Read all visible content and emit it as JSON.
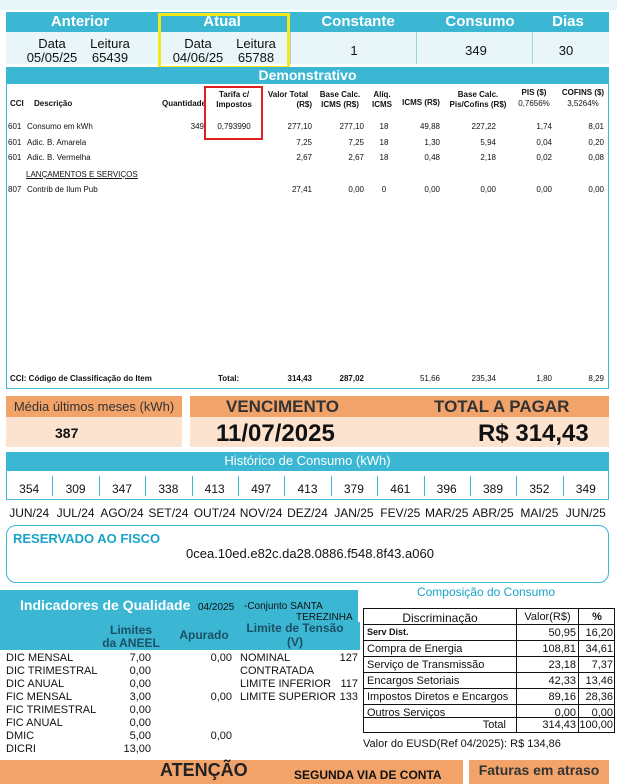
{
  "readings": {
    "headers": [
      "Anterior",
      "Atual",
      "Constante",
      "Consumo",
      "Dias"
    ],
    "sub_data": "Data",
    "sub_leitura": "Leitura",
    "anterior_data": "05/05/25",
    "anterior_leitura": "65439",
    "atual_data": "04/06/25",
    "atual_leitura": "65788",
    "constante": "1",
    "consumo": "349",
    "dias": "30"
  },
  "demo": {
    "title": "Demonstrativo",
    "cols": {
      "cci": "CCI",
      "desc": "Descrição",
      "qtd": "Quantidade",
      "tarifa1": "Tarifa c/",
      "tarifa2": "Impostos",
      "vt1": "Valor Total",
      "vt2": "(R$)",
      "bc1": "Base Calc.",
      "bc2": "ICMS (R$)",
      "aliq1": "Alíq.",
      "aliq2": "ICMS",
      "icms": "ICMS (R$)",
      "bcp1": "Base Calc.",
      "bcp2": "Pis/Cofins (R$)",
      "pis1": "PIS ($)",
      "pis2": "0,7656%",
      "cof1": "COFINS ($)",
      "cof2": "3,5264%"
    },
    "rows": [
      {
        "cci": "601",
        "desc": "Consumo em kWh",
        "qtd": "349",
        "tarifa": "0,793990",
        "vt": "277,10",
        "bc": "277,10",
        "aliq": "18",
        "icms": "49,88",
        "bcp": "227,22",
        "pis": "1,74",
        "cof": "8,01"
      },
      {
        "cci": "601",
        "desc": "Adic. B. Amarela",
        "qtd": "",
        "tarifa": "",
        "vt": "7,25",
        "bc": "7,25",
        "aliq": "18",
        "icms": "1,30",
        "bcp": "5,94",
        "pis": "0,04",
        "cof": "0,20"
      },
      {
        "cci": "601",
        "desc": "Adic. B. Vermelha",
        "qtd": "",
        "tarifa": "",
        "vt": "2,67",
        "bc": "2,67",
        "aliq": "18",
        "icms": "0,48",
        "bcp": "2,18",
        "pis": "0,02",
        "cof": "0,08"
      }
    ],
    "lanc": "LANÇAMENTOS E SERVIÇOS",
    "row4": {
      "cci": "807",
      "desc": "Contrib de Ilum Pub",
      "vt": "27,41",
      "bc": "0,00",
      "aliq": "0",
      "icms": "0,00",
      "bcp": "0,00",
      "pis": "0,00",
      "cof": "0,00"
    },
    "footer": {
      "label": "CCI: Código de Classificação do Item",
      "total": "Total:",
      "vt": "314,43",
      "bc": "287,02",
      "icms": "51,66",
      "bcp": "235,34",
      "pis": "1,80",
      "cof": "8,29"
    }
  },
  "media": {
    "label": "Média últimos meses (kWh)",
    "value": "387"
  },
  "vencimento": {
    "label": "VENCIMENTO",
    "value": "11/07/2025"
  },
  "total": {
    "label": "TOTAL A PAGAR",
    "value": "R$ 314,43"
  },
  "historico": {
    "title": "Histórico de Consumo (kWh)",
    "values": [
      "354",
      "309",
      "347",
      "338",
      "413",
      "497",
      "413",
      "379",
      "461",
      "396",
      "389",
      "352",
      "349"
    ],
    "months": [
      "JUN/24",
      "JUL/24",
      "AGO/24",
      "SET/24",
      "OUT/24",
      "NOV/24",
      "DEZ/24",
      "JAN/25",
      "FEV/25",
      "MAR/25",
      "ABR/25",
      "MAI/25",
      "JUN/25"
    ]
  },
  "fisco": {
    "label": "RESERVADO AO FISCO",
    "code": "0cea.10ed.e82c.da28.0886.f548.8f43.a060"
  },
  "indicadores": {
    "title": "Indicadores de Qualidade",
    "ref": "04/2025",
    "conj1": "-Conjunto SANTA",
    "conj2": "TEREZINHA",
    "col_limites1": "Limites",
    "col_limites2": "da ANEEL",
    "col_apurado": "Apurado",
    "col_tensao1": "Limite de Tensão",
    "col_tensao2": "(V)",
    "rows": [
      {
        "n": "DIC MENSAL",
        "l": "7,00",
        "a": "0,00"
      },
      {
        "n": "DIC TRIMESTRAL",
        "l": "0,00",
        "a": ""
      },
      {
        "n": "DIC ANUAL",
        "l": "0,00",
        "a": ""
      },
      {
        "n": "FIC MENSAL",
        "l": "3,00",
        "a": "0,00"
      },
      {
        "n": "FIC TRIMESTRAL",
        "l": "0,00",
        "a": ""
      },
      {
        "n": "FIC ANUAL",
        "l": "0,00",
        "a": ""
      },
      {
        "n": "DMIC",
        "l": "5,00",
        "a": "0,00"
      },
      {
        "n": "DICRI",
        "l": "13,00",
        "a": ""
      }
    ],
    "tensao": [
      {
        "n": "NOMINAL",
        "v": "127"
      },
      {
        "n": "CONTRATADA",
        "v": ""
      },
      {
        "n": "LIMITE INFERIOR",
        "v": "117"
      },
      {
        "n": "LIMITE SUPERIOR",
        "v": "133"
      }
    ]
  },
  "composicao": {
    "title": "Composição do Consumo",
    "h_disc": "Discriminação",
    "h_valor": "Valor(R$)",
    "h_pct": "%",
    "rows": [
      {
        "d": "Serv Dist.",
        "v": "50,95",
        "p": "16,20"
      },
      {
        "d": "Compra de Energia",
        "v": "108,81",
        "p": "34,61"
      },
      {
        "d": "Serviço de Transmissão",
        "v": "23,18",
        "p": "7,37"
      },
      {
        "d": "Encargos Setoriais",
        "v": "42,33",
        "p": "13,46"
      },
      {
        "d": "Impostos Diretos e Encargos",
        "v": "89,16",
        "p": "28,36"
      },
      {
        "d": "Outros Serviços",
        "v": "0,00",
        "p": "0,00"
      }
    ],
    "total_label": "Total",
    "total_v": "314,43",
    "total_p": "100,00",
    "eusd": "Valor do EUSD(Ref 04/2025): R$ 134,86"
  },
  "bottom": {
    "atencao": "ATENÇÃO",
    "segunda": "SEGUNDA VIA DE CONTA",
    "faturas": "Faturas em atraso"
  },
  "colors": {
    "header": "#3bb7d4",
    "light": "#e8f5f9",
    "orange": "#f2a36a",
    "orange_light": "#fbe3cf",
    "highlight_yellow": "#f4e81a",
    "highlight_red": "#e02020"
  }
}
